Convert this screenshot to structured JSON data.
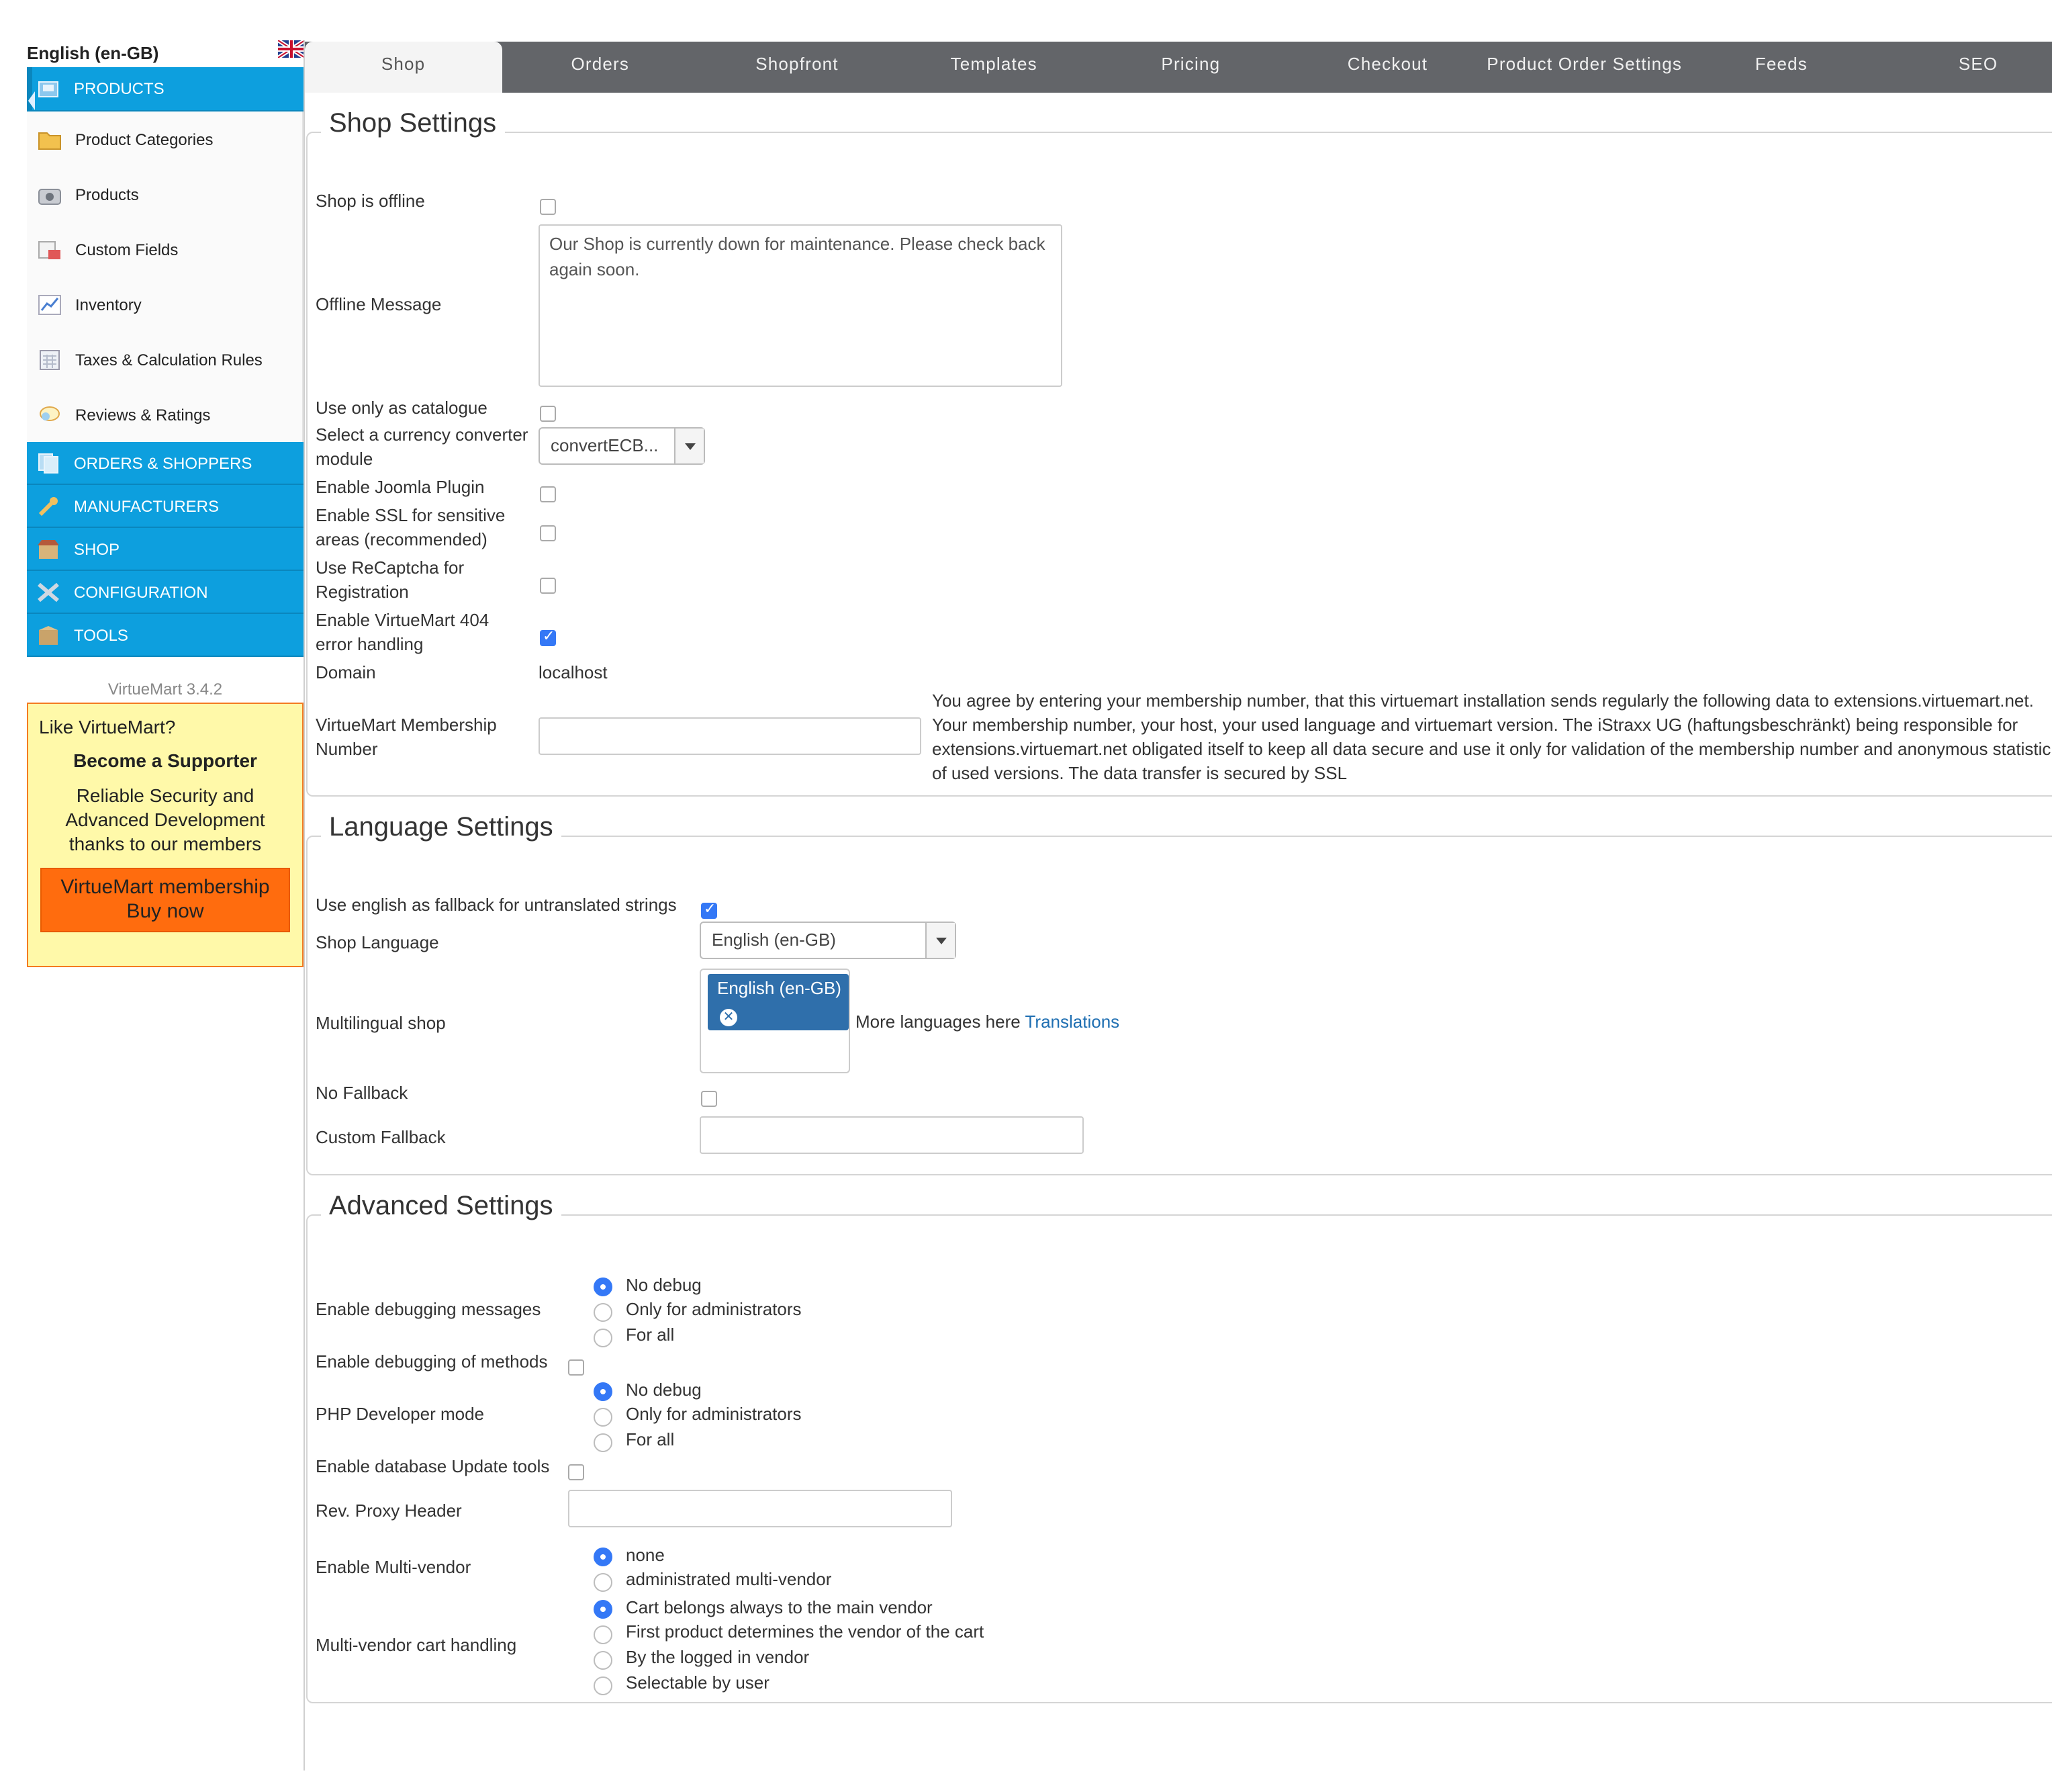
{
  "language_label": "English (en-GB)",
  "sidebar": {
    "products_header": "PRODUCTS",
    "items": [
      {
        "label": "Product Categories",
        "icon": "folder-icon"
      },
      {
        "label": "Products",
        "icon": "camera-icon"
      },
      {
        "label": "Custom Fields",
        "icon": "custom-fields-icon"
      },
      {
        "label": "Inventory",
        "icon": "chart-icon"
      },
      {
        "label": "Taxes & Calculation Rules",
        "icon": "calculator-icon"
      },
      {
        "label": "Reviews & Ratings",
        "icon": "speech-bubble-icon"
      }
    ],
    "sections": [
      {
        "label": "ORDERS & SHOPPERS",
        "icon": "documents-icon"
      },
      {
        "label": "MANUFACTURERS",
        "icon": "wrench-icon"
      },
      {
        "label": "SHOP",
        "icon": "shop-icon"
      },
      {
        "label": "CONFIGURATION",
        "icon": "tools-icon"
      },
      {
        "label": "TOOLS",
        "icon": "box-icon"
      }
    ],
    "version": "VirtueMart 3.4.2"
  },
  "promo": {
    "question": "Like VirtueMart?",
    "headline": "Become a Supporter",
    "text": "Reliable Security and Advanced Development thanks to our members",
    "button_line1": "VirtueMart membership",
    "button_line2": "Buy now"
  },
  "tabs": [
    "Shop",
    "Orders",
    "Shopfront",
    "Templates",
    "Pricing",
    "Checkout",
    "Product Order Settings",
    "Feeds",
    "SEO"
  ],
  "active_tab": "Shop",
  "shop_settings": {
    "legend": "Shop Settings",
    "shop_offline_label": "Shop is offline",
    "offline_message_label": "Offline Message",
    "offline_message_value": "Our Shop is currently down for maintenance. Please check back again soon.",
    "catalogue_label": "Use only as catalogue",
    "currency_converter_label": "Select a currency converter module",
    "currency_converter_value": "convertECB...",
    "joomla_plugin_label": "Enable Joomla Plugin",
    "ssl_label": "Enable SSL for sensitive areas (recommended)",
    "recaptcha_label": "Use ReCaptcha for Registration",
    "error404_label": "Enable VirtueMart 404 error handling",
    "domain_label": "Domain",
    "domain_value": "localhost",
    "membership_label": "VirtueMart Membership Number",
    "membership_value": "",
    "membership_note": "You agree by entering your membership number, that this virtuemart installation sends regularly the following data to extensions.virtuemart.net. Your membership number, your host, your used language and virtuemart version. The iStraxx UG (haftungsbeschränkt) being responsible for extensions.virtuemart.net obligated itself to keep all data secure and use it only for validation of the membership number and anonymous statistic of used versions. The data transfer is secured by SSL",
    "checks": {
      "offline": false,
      "catalogue": false,
      "joomla": false,
      "ssl": false,
      "recaptcha": false,
      "error404": true
    }
  },
  "language_settings": {
    "legend": "Language Settings",
    "fallback_label": "Use english as fallback for untranslated strings",
    "fallback_checked": true,
    "shop_language_label": "Shop Language",
    "shop_language_value": "English (en-GB)",
    "multilingual_label": "Multilingual shop",
    "multilingual_tag": "English (en-GB)",
    "more_languages_text": "More languages here",
    "translations_link": "Translations",
    "no_fallback_label": "No Fallback",
    "no_fallback_checked": false,
    "custom_fallback_label": "Custom Fallback",
    "custom_fallback_value": ""
  },
  "advanced_settings": {
    "legend": "Advanced Settings",
    "debug_label": "Enable debugging messages",
    "debug_options": [
      "No debug",
      "Only for administrators",
      "For all"
    ],
    "debug_selected": "No debug",
    "debug_methods_label": "Enable debugging of methods",
    "debug_methods_checked": false,
    "php_dev_label": "PHP Developer mode",
    "php_dev_options": [
      "No debug",
      "Only for administrators",
      "For all"
    ],
    "php_dev_selected": "No debug",
    "db_update_label": "Enable database Update tools",
    "db_update_checked": false,
    "proxy_label": "Rev. Proxy Header",
    "proxy_value": "",
    "multivendor_label": "Enable Multi-vendor",
    "multivendor_options": [
      "none",
      "administrated multi-vendor"
    ],
    "multivendor_selected": "none",
    "cart_handling_label": "Multi-vendor cart handling",
    "cart_handling_options": [
      "Cart belongs always to the main vendor",
      "First product determines the vendor of the cart",
      "By the logged in vendor",
      "Selectable by user"
    ],
    "cart_handling_selected": "Cart belongs always to the main vendor"
  },
  "colors": {
    "accent_blue": "#0d9fde",
    "tab_bar": "#636569",
    "promo_bg": "#fff9a9",
    "promo_button": "#ff6c0e",
    "checkbox_blue": "#3478f6"
  }
}
